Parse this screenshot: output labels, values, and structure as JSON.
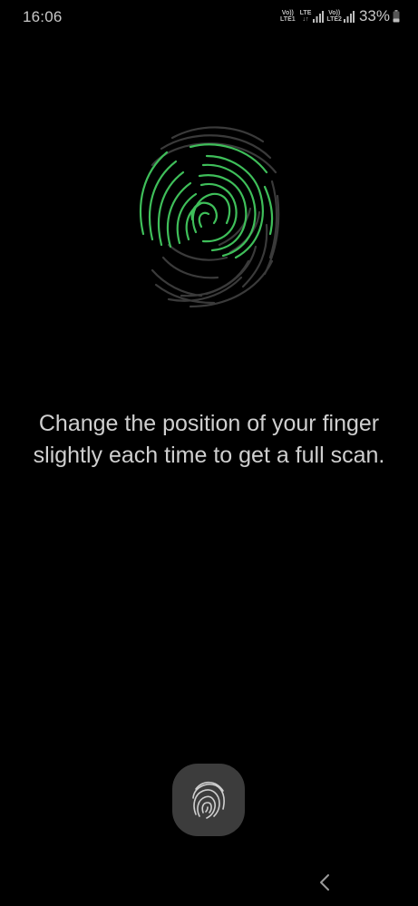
{
  "status_bar": {
    "time": "16:06",
    "sim1": {
      "top": "Vo))",
      "bottom": "LTE1"
    },
    "data": {
      "top": "LTE",
      "bottom": "↓↑"
    },
    "sim2": {
      "top": "Vo))",
      "bottom": "LTE2"
    },
    "battery_percent": "33%"
  },
  "enrollment": {
    "instruction": "Change the position of your finger slightly each time to get a full scan."
  },
  "colors": {
    "background": "#000000",
    "progress_ridge": "#3fbf5a",
    "idle_ridge": "#3a3a3a",
    "text": "#cfcfcf",
    "sensor_button": "#3c3c3c"
  },
  "icons": {
    "fingerprint": "fingerprint-icon",
    "sensor": "fingerprint-sensor-icon",
    "back": "back-chevron-icon"
  }
}
